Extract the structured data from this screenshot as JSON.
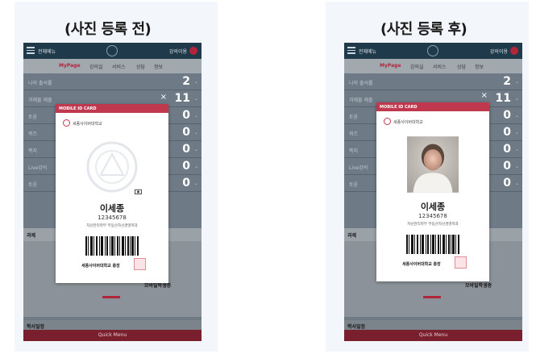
{
  "panels": [
    {
      "caption": "(사진 등록 전)",
      "app": {
        "menu_label": "전체메뉴",
        "user_label": "강의이용"
      },
      "nav": [
        "MyPage",
        "강의실",
        "서비스",
        "상담",
        "정보"
      ],
      "rows": [
        {
          "label": "나의 출석률",
          "value": "2"
        },
        {
          "label": "과제물 제출",
          "value": "11"
        },
        {
          "label": "토론",
          "value": "0"
        },
        {
          "label": "퀴즈",
          "value": "0"
        },
        {
          "label": "쪽지",
          "value": "0"
        },
        {
          "label": "Live강의",
          "value": "0"
        },
        {
          "label": "토론",
          "value": "0"
        }
      ],
      "tab_label": "과제",
      "banner_label": "모바일학생증",
      "schedule_label": "학사일정",
      "quick_menu": "Quick Menu",
      "card": {
        "header": "MOBILE ID CARD",
        "close": "×",
        "university": "세종사이버대학교",
        "has_photo": false,
        "name": "이세종",
        "student_id": "12345678",
        "department": "자산관리학부 부동산자산경영학과",
        "signature": "세종사이버대학교 총장"
      }
    },
    {
      "caption": "(사진 등록 후)",
      "app": {
        "menu_label": "전체메뉴",
        "user_label": "강의이용"
      },
      "nav": [
        "MyPage",
        "강의실",
        "서비스",
        "상담",
        "정보"
      ],
      "rows": [
        {
          "label": "나의 출석률",
          "value": "2"
        },
        {
          "label": "과제물 제출",
          "value": "11"
        },
        {
          "label": "토론",
          "value": "0"
        },
        {
          "label": "퀴즈",
          "value": "0"
        },
        {
          "label": "쪽지",
          "value": "0"
        },
        {
          "label": "Live강의",
          "value": "0"
        },
        {
          "label": "토론",
          "value": "0"
        }
      ],
      "tab_label": "과제",
      "banner_label": "모바일학생증",
      "schedule_label": "학사일정",
      "quick_menu": "Quick Menu",
      "card": {
        "header": "MOBILE ID CARD",
        "close": "×",
        "university": "세종사이버대학교",
        "has_photo": true,
        "name": "이세종",
        "student_id": "12345678",
        "department": "자산관리학부 부동산자산경영학과",
        "signature": "세종사이버대학교 총장"
      }
    }
  ]
}
